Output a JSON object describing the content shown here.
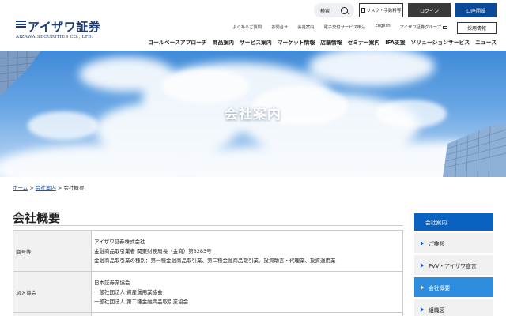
{
  "header": {
    "logo_text": "アイザワ証券",
    "logo_subtitle": "AIZAWA SECURITIES CO., LTD.",
    "search_label": "検索",
    "risk_button": "リスク・手数料等",
    "login_button": "ログイン",
    "open_account_button": "口座開設",
    "sub_nav": [
      "よくあるご質問",
      "お問合せ",
      "会社案内",
      "電子交付サービス申込",
      "English",
      "アイザワ証券グループ"
    ],
    "recruit_button": "採用情報",
    "main_nav": [
      "ゴールベースアプローチ",
      "商品案内",
      "サービス案内",
      "マーケット情報",
      "店舗情報",
      "セミナー案内",
      "IFA支援",
      "ソリューションサービス",
      "ニュース"
    ]
  },
  "hero": {
    "title": "会社案内"
  },
  "breadcrumb": {
    "home": "ホーム",
    "sep": " > ",
    "parent": "会社案内",
    "current": "会社概要"
  },
  "content": {
    "heading": "会社概要",
    "rows": [
      {
        "label": "商号等",
        "lines": [
          "アイザワ証券株式会社",
          "金融商品取引業者 関東財務局長（金商）第3283号",
          "金融商品取引業の種別：第一種金融商品取引業、第二種金融商品取引業、投資助言・代理業、投資運用業"
        ]
      },
      {
        "label": "加入協会",
        "lines": [
          "日本証券業協会",
          "一般社団法人 資産運用業協会",
          "一般社団法人 第二種金融商品取引業協会"
        ]
      }
    ]
  },
  "sidebar": {
    "heading": "会社案内",
    "items": [
      {
        "label": "ご挨拶",
        "active": false
      },
      {
        "label": "PVV・アイザワ宣言",
        "active": false
      },
      {
        "label": "会社概要",
        "active": true
      },
      {
        "label": "組織図",
        "active": false
      }
    ]
  },
  "colors": {
    "brand_navy": "#1a3d7c",
    "accent_blue": "#0a62c0",
    "active_blue": "#2f8de0"
  },
  "icons": [
    "search-icon",
    "document-icon",
    "external-window-icon",
    "triangle-right-icon"
  ]
}
